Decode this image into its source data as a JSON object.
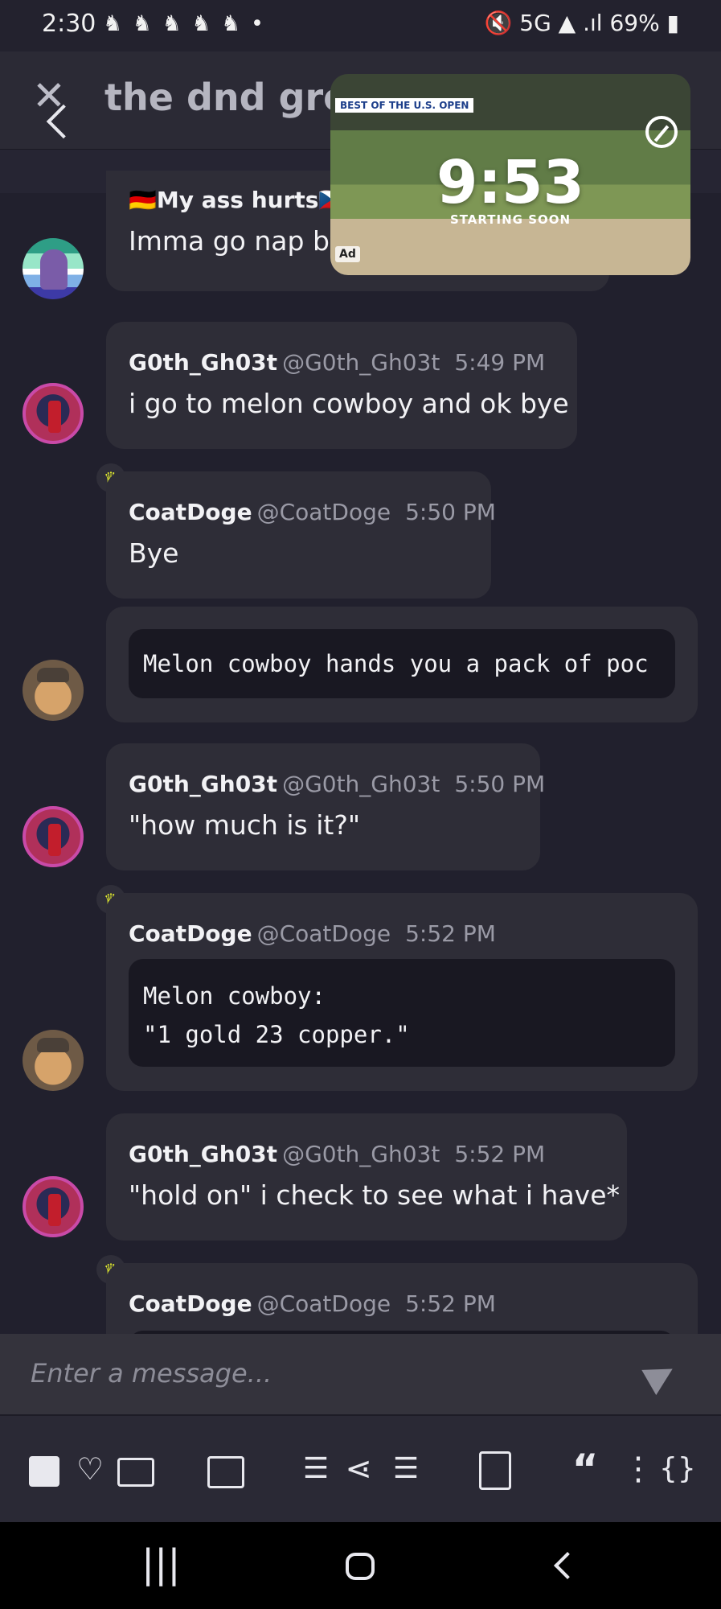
{
  "status": {
    "time": "2:30",
    "notifications": "♞ ♞ ♞ ♞ ♞ •",
    "right": "🔇 5G ▲ .ıl 69% ▮",
    "battery": "69%"
  },
  "header": {
    "title": "the dnd group"
  },
  "pip": {
    "tag": "BEST OF THE U.S. OPEN",
    "countdown": "9:53",
    "subtitle": "STARTING SOON",
    "ad": "Ad"
  },
  "messages": [
    {
      "top_line": "🇩🇪My ass hurts🇨🇿",
      "text": "Imma go nap by"
    },
    {
      "name": "G0th_Gh03t",
      "handle": "@G0th_Gh03t",
      "time": "5:49 PM",
      "text": "i go to melon cowboy and ok bye"
    },
    {
      "name": "CoatDoge",
      "handle": "@CoatDoge",
      "time": "5:50 PM",
      "text": "Bye"
    },
    {
      "code": "Melon cowboy hands you a pack of poc"
    },
    {
      "name": "G0th_Gh03t",
      "handle": "@G0th_Gh03t",
      "time": "5:50 PM",
      "text": "\"how much is it?\""
    },
    {
      "name": "CoatDoge",
      "handle": "@CoatDoge",
      "time": "5:52 PM",
      "code": "Melon cowboy:\n\"1 gold 23 copper.\""
    },
    {
      "name": "G0th_Gh03t",
      "handle": "@G0th_Gh03t",
      "time": "5:52 PM",
      "text": "\"hold on\" i check to see what i have*"
    },
    {
      "name": "CoatDoge",
      "handle": "@CoatDoge",
      "time": "5:52 PM"
    }
  ],
  "input": {
    "placeholder": "Enter a message..."
  },
  "toolbar": {
    "icons": [
      "spoiler-icon",
      "heart-icon",
      "image-icon",
      "draw-icon",
      "bullet-list-icon",
      "share-icon",
      "numbered-list-icon",
      "trash-icon",
      "quote-icon",
      "more-icon",
      "code-icon"
    ]
  },
  "navbar": {
    "recents": "|||"
  }
}
